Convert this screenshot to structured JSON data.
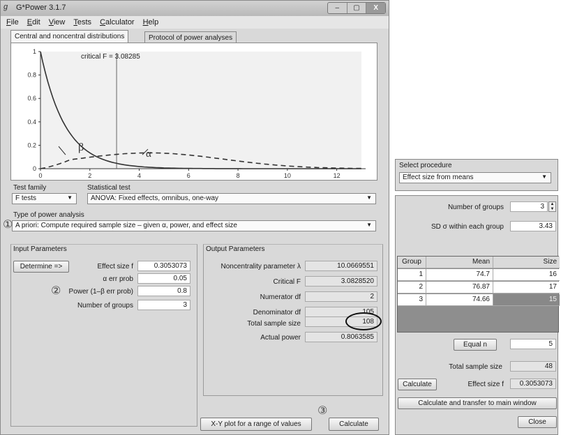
{
  "window": {
    "icon_glyph": "g",
    "title": "G*Power 3.1.7",
    "controls": [
      "–",
      "▢",
      "X"
    ]
  },
  "menu": [
    "File",
    "Edit",
    "View",
    "Tests",
    "Calculator",
    "Help"
  ],
  "tabs": [
    "Central and noncentral distributions",
    "Protocol of power analyses"
  ],
  "plot": {
    "critical_label": "critical F = 3.08285",
    "beta_label": "β",
    "alpha_label": "α",
    "y_ticks": [
      "0",
      "0.2",
      "0.4",
      "0.6",
      "0.8",
      "1"
    ],
    "x_ticks": [
      "0",
      "2",
      "4",
      "6",
      "8",
      "10",
      "12"
    ],
    "critical_f": 3.08285
  },
  "test": {
    "family_label": "Test family",
    "family_value": "F tests",
    "statistical_label": "Statistical test",
    "statistical_value": "ANOVA: Fixed effects, omnibus, one-way",
    "type_label": "Type of power analysis",
    "type_value": "A priori: Compute required sample size – given α, power, and effect size"
  },
  "annotations": {
    "one": "①",
    "two": "②",
    "three": "③"
  },
  "input": {
    "title": "Input Parameters",
    "determine_button": "Determine =>",
    "effect_size_label": "Effect size f",
    "effect_size_value": "0.3053073",
    "alpha_label": "α err prob",
    "alpha_value": "0.05",
    "power_label": "Power (1–β err prob)",
    "power_value": "0.8",
    "groups_label": "Number of groups",
    "groups_value": "3"
  },
  "output": {
    "title": "Output Parameters",
    "noncentrality_label": "Noncentrality parameter λ",
    "noncentrality_value": "10.0669551",
    "critical_label": "Critical F",
    "critical_value": "3.0828520",
    "numerator_label": "Numerator df",
    "numerator_value": "2",
    "denominator_label": "Denominator df",
    "denominator_value": "105",
    "total_label": "Total sample size",
    "total_value": "108",
    "power_label": "Actual power",
    "power_value": "0.8063585"
  },
  "buttons": {
    "xy_plot": "X-Y plot for a range of values",
    "calculate": "Calculate"
  },
  "side": {
    "procedure_label": "Select procedure",
    "procedure_value": "Effect size from means",
    "groups_label": "Number of groups",
    "groups_value": "3",
    "sd_label": "SD σ within each group",
    "sd_value": "3.43",
    "table_headers": [
      "Group",
      "Mean",
      "Size"
    ],
    "rows": [
      {
        "group": "1",
        "mean": "74.7",
        "size": "16"
      },
      {
        "group": "2",
        "mean": "76.87",
        "size": "17"
      },
      {
        "group": "3",
        "mean": "74.66",
        "size": "15"
      }
    ],
    "equal_n_button": "Equal n",
    "equal_n_value": "5",
    "total_label": "Total sample size",
    "total_value": "48",
    "calculate_button": "Calculate",
    "effect_label": "Effect size f",
    "effect_value": "0.3053073",
    "transfer_button": "Calculate and transfer to main window",
    "close_button": "Close"
  }
}
